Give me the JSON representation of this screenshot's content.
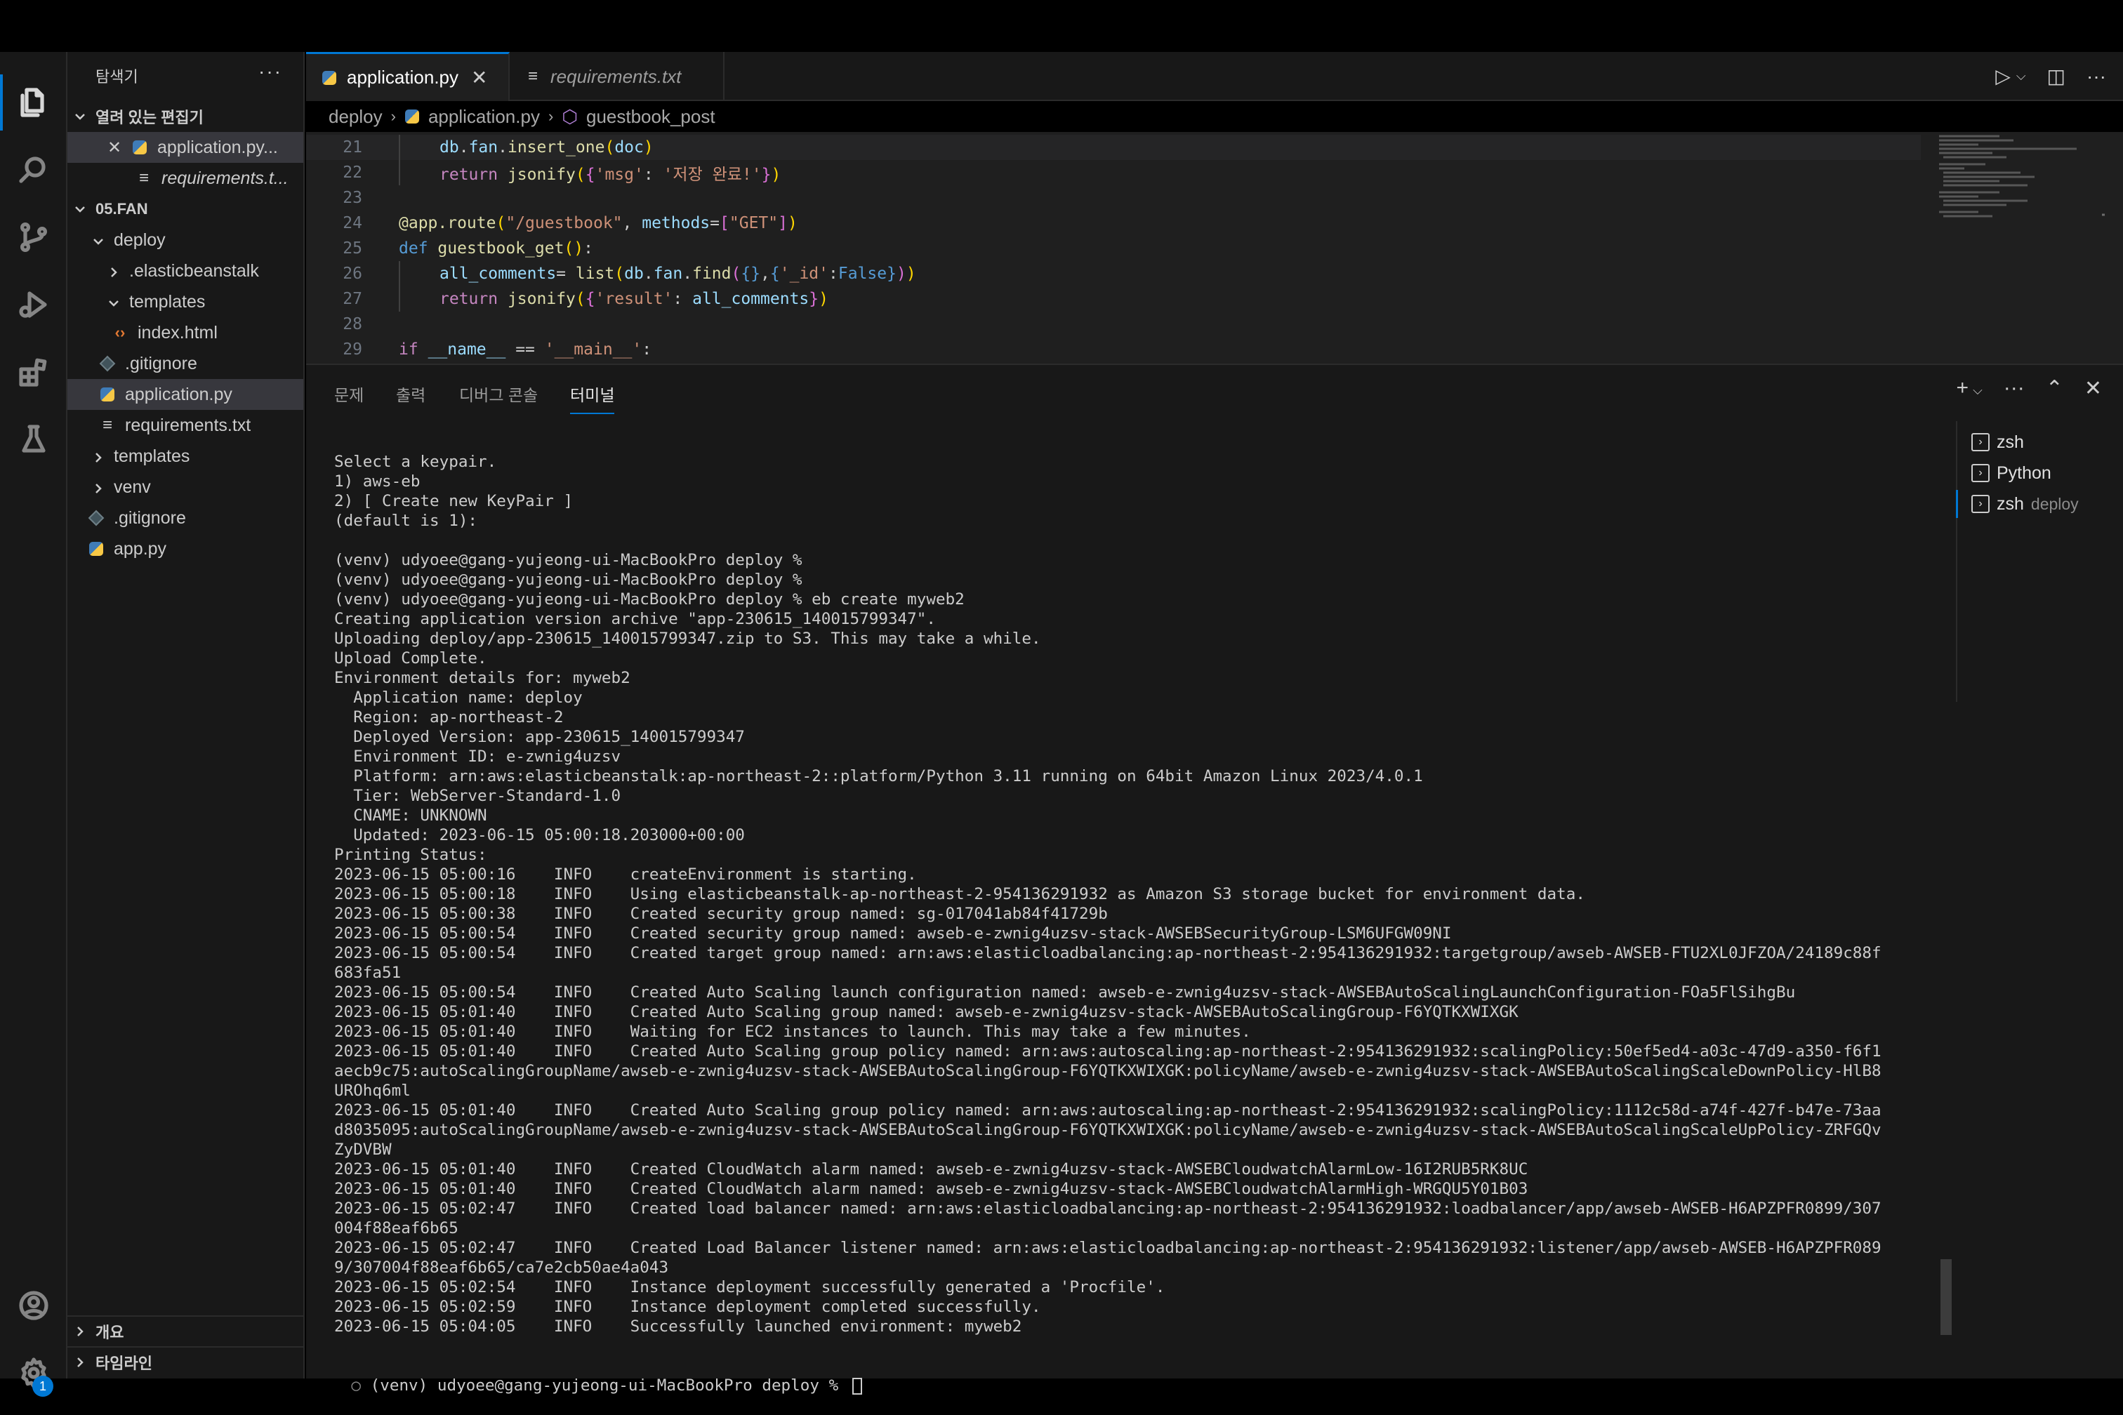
{
  "explorer": {
    "title": "탐색기",
    "more": "···",
    "open_editors_header": "열려 있는 편집기",
    "open_editors": [
      {
        "label": "application.py..."
      },
      {
        "label": "requirements.t..."
      }
    ],
    "project_header": "05.FAN",
    "tree": [
      {
        "label": "deploy"
      },
      {
        "label": ".elasticbeanstalk"
      },
      {
        "label": "templates"
      },
      {
        "label": "index.html"
      },
      {
        "label": ".gitignore"
      },
      {
        "label": "application.py"
      },
      {
        "label": "requirements.txt"
      },
      {
        "label": "templates"
      },
      {
        "label": "venv"
      },
      {
        "label": ".gitignore"
      },
      {
        "label": "app.py"
      }
    ],
    "outline_label": "개요",
    "timeline_label": "타임라인"
  },
  "tabs": [
    {
      "label": "application.py",
      "close": "✕"
    },
    {
      "label": "requirements.txt"
    }
  ],
  "breadcrumb": [
    "deploy",
    "application.py",
    "guestbook_post"
  ],
  "code_lines": [
    {
      "n": "21"
    },
    {
      "n": "22"
    },
    {
      "n": "23"
    },
    {
      "n": "24"
    },
    {
      "n": "25"
    },
    {
      "n": "26"
    },
    {
      "n": "27"
    },
    {
      "n": "28"
    },
    {
      "n": "29"
    }
  ],
  "panel": {
    "tabs": [
      "문제",
      "출력",
      "디버그 콘솔",
      "터미널"
    ],
    "active_tab": "터미널",
    "terminals": [
      {
        "label": "zsh",
        "sub": ""
      },
      {
        "label": "Python",
        "sub": ""
      },
      {
        "label": "zsh",
        "sub": "deploy"
      }
    ]
  },
  "terminal_lines": [
    "Select a keypair.",
    "1) aws-eb",
    "2) [ Create new KeyPair ]",
    "(default is 1):",
    "",
    "(venv) udyoee@gang-yujeong-ui-MacBookPro deploy %",
    "(venv) udyoee@gang-yujeong-ui-MacBookPro deploy %",
    "(venv) udyoee@gang-yujeong-ui-MacBookPro deploy % eb create myweb2",
    "Creating application version archive \"app-230615_140015799347\".",
    "Uploading deploy/app-230615_140015799347.zip to S3. This may take a while.",
    "Upload Complete.",
    "Environment details for: myweb2",
    "  Application name: deploy",
    "  Region: ap-northeast-2",
    "  Deployed Version: app-230615_140015799347",
    "  Environment ID: e-zwnig4uzsv",
    "  Platform: arn:aws:elasticbeanstalk:ap-northeast-2::platform/Python 3.11 running on 64bit Amazon Linux 2023/4.0.1",
    "  Tier: WebServer-Standard-1.0",
    "  CNAME: UNKNOWN",
    "  Updated: 2023-06-15 05:00:18.203000+00:00",
    "Printing Status:",
    "2023-06-15 05:00:16    INFO    createEnvironment is starting.",
    "2023-06-15 05:00:18    INFO    Using elasticbeanstalk-ap-northeast-2-954136291932 as Amazon S3 storage bucket for environment data.",
    "2023-06-15 05:00:38    INFO    Created security group named: sg-017041ab84f41729b",
    "2023-06-15 05:00:54    INFO    Created security group named: awseb-e-zwnig4uzsv-stack-AWSEBSecurityGroup-LSM6UFGW09NI",
    "2023-06-15 05:00:54    INFO    Created target group named: arn:aws:elasticloadbalancing:ap-northeast-2:954136291932:targetgroup/awseb-AWSEB-FTU2XL0JFZOA/24189c88f",
    "683fa51",
    "2023-06-15 05:00:54    INFO    Created Auto Scaling launch configuration named: awseb-e-zwnig4uzsv-stack-AWSEBAutoScalingLaunchConfiguration-FOa5FlSihgBu",
    "2023-06-15 05:01:40    INFO    Created Auto Scaling group named: awseb-e-zwnig4uzsv-stack-AWSEBAutoScalingGroup-F6YQTKXWIXGK",
    "2023-06-15 05:01:40    INFO    Waiting for EC2 instances to launch. This may take a few minutes.",
    "2023-06-15 05:01:40    INFO    Created Auto Scaling group policy named: arn:aws:autoscaling:ap-northeast-2:954136291932:scalingPolicy:50ef5ed4-a03c-47d9-a350-f6f1",
    "aecb9c75:autoScalingGroupName/awseb-e-zwnig4uzsv-stack-AWSEBAutoScalingGroup-F6YQTKXWIXGK:policyName/awseb-e-zwnig4uzsv-stack-AWSEBAutoScalingScaleDownPolicy-HlB8",
    "UROhq6ml",
    "2023-06-15 05:01:40    INFO    Created Auto Scaling group policy named: arn:aws:autoscaling:ap-northeast-2:954136291932:scalingPolicy:1112c58d-a74f-427f-b47e-73aa",
    "d8035095:autoScalingGroupName/awseb-e-zwnig4uzsv-stack-AWSEBAutoScalingGroup-F6YQTKXWIXGK:policyName/awseb-e-zwnig4uzsv-stack-AWSEBAutoScalingScaleUpPolicy-ZRFGQv",
    "ZyDVBW",
    "2023-06-15 05:01:40    INFO    Created CloudWatch alarm named: awseb-e-zwnig4uzsv-stack-AWSEBCloudwatchAlarmLow-16I2RUB5RK8UC",
    "2023-06-15 05:01:40    INFO    Created CloudWatch alarm named: awseb-e-zwnig4uzsv-stack-AWSEBCloudwatchAlarmHigh-WRGQU5Y01B03",
    "2023-06-15 05:02:47    INFO    Created load balancer named: arn:aws:elasticloadbalancing:ap-northeast-2:954136291932:loadbalancer/app/awseb-AWSEB-H6APZPFR0899/307",
    "004f88eaf6b65",
    "2023-06-15 05:02:47    INFO    Created Load Balancer listener named: arn:aws:elasticloadbalancing:ap-northeast-2:954136291932:listener/app/awseb-AWSEB-H6APZPFR089",
    "9/307004f88eaf6b65/ca7e2cb50ae4a043",
    "2023-06-15 05:02:54    INFO    Instance deployment successfully generated a 'Procfile'.",
    "2023-06-15 05:02:59    INFO    Instance deployment completed successfully.",
    "2023-06-15 05:04:05    INFO    Successfully launched environment: myweb2"
  ],
  "prompt_line": {
    "marker": "○",
    "text": "(venv) udyoee@gang-yujeong-ui-MacBookPro deploy %"
  },
  "settings_badge": "1"
}
